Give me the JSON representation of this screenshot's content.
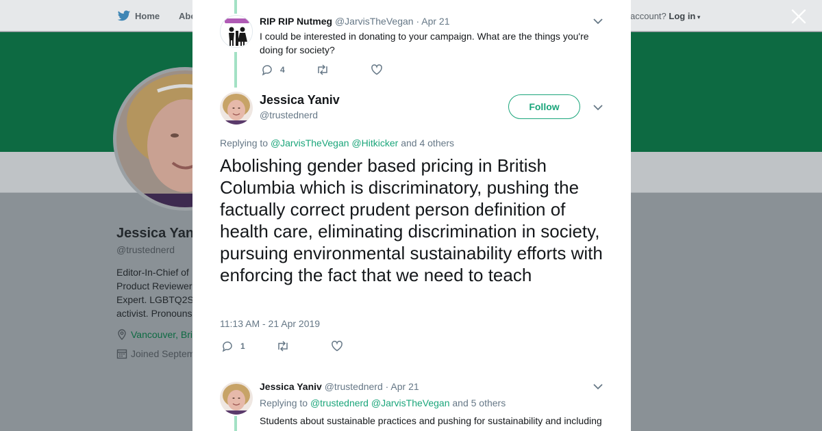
{
  "background": {
    "nav": {
      "home": "Home",
      "about": "Abo",
      "account": "account?",
      "login": "Log in"
    },
    "profile": {
      "name": "Jessica Yan",
      "handle": "@trustednerd",
      "bio": [
        "Editor-In-Chief of",
        "Product Reviewer",
        "Expert. LGBTQ2S",
        "activist. Pronouns"
      ],
      "location": "Vancouver, Bri",
      "joined": "Joined Septem"
    },
    "colors": {
      "banner": "#0d6a42",
      "dim": "#8a9196"
    }
  },
  "modal": {
    "parent_tweet": {
      "name": "RIP RIP Nutmeg",
      "handle": "@JarvisTheVegan",
      "date": "· Apr 21",
      "text": "I could be interested in donating to your campaign. What are the things you're doing for society?",
      "reply_count": "4",
      "icons": [
        "reply-icon",
        "retweet-icon",
        "like-icon"
      ]
    },
    "main_tweet": {
      "name": "Jessica Yaniv",
      "handle": "@trustednerd",
      "follow_label": "Follow",
      "replying_prefix": "Replying to",
      "mention_1": "@JarvisTheVegan",
      "mention_2": "@Hitkicker",
      "others": "and 4 others",
      "text": "Abolishing gender based pricing in British Columbia which is discriminatory, pushing the factually correct prudent person definition of health care, eliminating discrimination in society, pursuing environmental sustainability efforts with enforcing the fact that we need to teach",
      "timestamp": "11:13 AM - 21 Apr 2019",
      "reply_count": "1"
    },
    "reply_tweet": {
      "name": "Jessica Yaniv",
      "handle": "@trustednerd",
      "date": "· Apr 21",
      "replying_prefix": "Replying to",
      "mention_1": "@trustednerd",
      "mention_2": "@JarvisTheVegan",
      "others": "and 5 others",
      "text": "Students about sustainable practices and pushing for sustainability and including"
    },
    "colors": {
      "accent": "#1aa57a",
      "thread_line": "#a3e1c4",
      "muted": "#657786"
    }
  }
}
